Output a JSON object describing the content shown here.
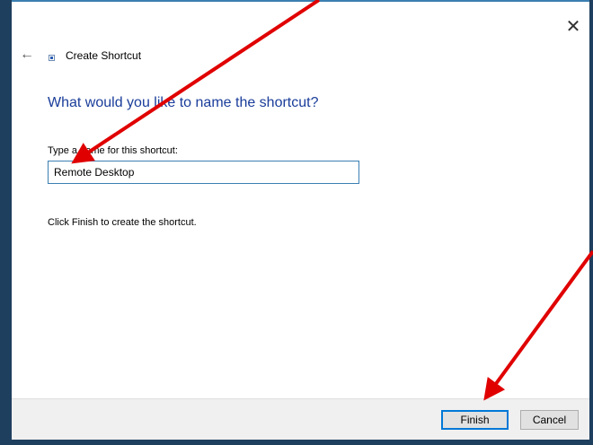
{
  "window": {
    "close_glyph": "✕"
  },
  "wizard": {
    "back_glyph": "←",
    "title": "Create Shortcut",
    "heading": "What would you like to name the shortcut?",
    "field_label": "Type a name for this shortcut:",
    "field_value": "Remote Desktop",
    "instruction": "Click Finish to create the shortcut."
  },
  "footer": {
    "finish_label": "Finish",
    "cancel_label": "Cancel"
  },
  "colors": {
    "heading": "#1a3d9a",
    "accent": "#0078d7",
    "annotation_arrow": "#e00000"
  },
  "icons": {
    "close": "close-icon",
    "back": "back-arrow-icon",
    "wizard": "shortcut-icon"
  }
}
